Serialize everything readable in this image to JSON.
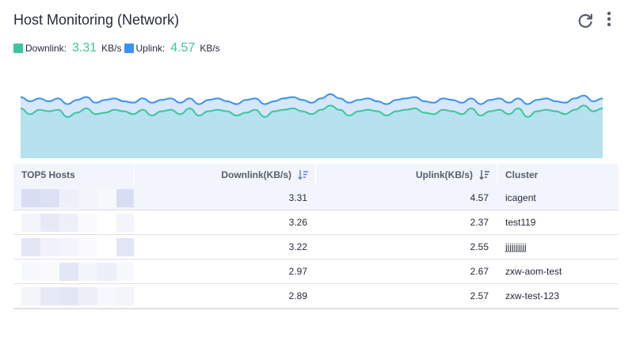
{
  "header": {
    "title": "Host Monitoring (Network)",
    "refresh_icon": "refresh-icon",
    "more_icon": "more-vertical-icon"
  },
  "legend": {
    "downlink": {
      "label": "Downlink:",
      "value": "3.31",
      "unit": "KB/s",
      "color": "#3bc69c"
    },
    "uplink": {
      "label": "Uplink:",
      "value": "4.57",
      "unit": "KB/s",
      "color": "#3893f2"
    }
  },
  "colors": {
    "accent_value": "#3bc69c",
    "header_bg": "#f2f5fc",
    "border": "#dfe1e6"
  },
  "chart_data": {
    "type": "area",
    "series": [
      {
        "values": [
          0.7,
          0.62,
          0.68,
          0.66,
          0.68,
          0.58,
          0.64,
          0.7,
          0.62,
          0.64,
          0.68,
          0.66,
          0.62,
          0.68,
          0.6,
          0.66,
          0.68,
          0.62,
          0.7,
          0.6,
          0.66,
          0.68,
          0.66,
          0.6,
          0.64,
          0.68,
          0.58,
          0.66,
          0.68,
          0.7,
          0.66,
          0.62,
          0.68,
          0.74,
          0.68,
          0.6,
          0.66,
          0.68,
          0.66,
          0.6,
          0.66,
          0.68,
          0.7,
          0.64,
          0.62,
          0.68,
          0.66,
          0.62,
          0.7,
          0.6,
          0.66,
          0.68,
          0.62,
          0.7,
          0.58,
          0.66,
          0.68,
          0.66,
          0.62,
          0.68,
          0.74,
          0.66,
          0.7
        ]
      },
      {
        "values": [
          0.86,
          0.8,
          0.84,
          0.8,
          0.84,
          0.76,
          0.82,
          0.86,
          0.78,
          0.82,
          0.84,
          0.8,
          0.78,
          0.84,
          0.78,
          0.82,
          0.84,
          0.78,
          0.84,
          0.76,
          0.82,
          0.84,
          0.8,
          0.76,
          0.82,
          0.84,
          0.76,
          0.8,
          0.84,
          0.86,
          0.82,
          0.78,
          0.84,
          0.9,
          0.84,
          0.78,
          0.82,
          0.84,
          0.8,
          0.76,
          0.82,
          0.84,
          0.86,
          0.8,
          0.78,
          0.84,
          0.82,
          0.78,
          0.84,
          0.76,
          0.82,
          0.84,
          0.78,
          0.84,
          0.76,
          0.82,
          0.84,
          0.8,
          0.78,
          0.84,
          0.88,
          0.8,
          0.84
        ]
      }
    ]
  },
  "table": {
    "columns": {
      "host": "TOP5 Hosts",
      "downlink": "Downlink(KB/s)",
      "uplink": "Uplink(KB/s)",
      "cluster": "Cluster"
    },
    "sort_icon": "sort-descending-icon",
    "rows": [
      {
        "downlink": "3.31",
        "uplink": "4.57",
        "cluster": "icagent"
      },
      {
        "downlink": "3.26",
        "uplink": "2.37",
        "cluster": "test119"
      },
      {
        "downlink": "3.22",
        "uplink": "2.55",
        "cluster": "jjjjjjjjjj"
      },
      {
        "downlink": "2.97",
        "uplink": "2.67",
        "cluster": "zxw-aom-test"
      },
      {
        "downlink": "2.89",
        "uplink": "2.57",
        "cluster": "zxw-test-123"
      }
    ]
  }
}
